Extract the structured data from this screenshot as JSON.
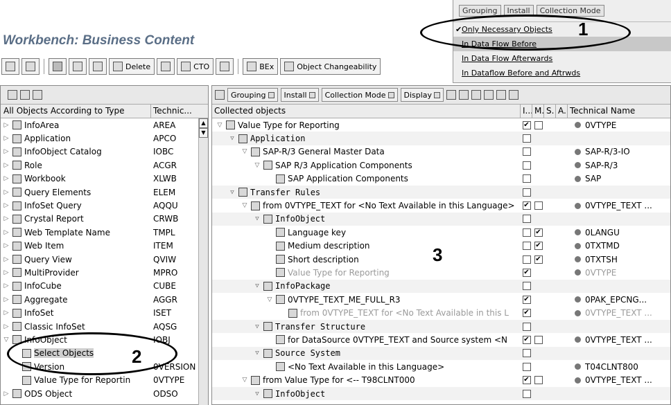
{
  "window": {
    "title": "Workbench: Business Content"
  },
  "toolbar": {
    "buttons": [
      "Delete",
      "CTO",
      "BEx",
      "Object Changeability"
    ]
  },
  "grouping_menu": {
    "top_buttons": [
      "Grouping",
      "Install",
      "Collection Mode"
    ],
    "items": [
      {
        "label": "Only Necessary Objects",
        "checked": true
      },
      {
        "label": "In Data Flow Before",
        "checked": false
      },
      {
        "label": "In Data Flow Afterwards",
        "checked": false
      },
      {
        "label": "In Dataflow Before and Aftrwds",
        "checked": false
      }
    ]
  },
  "callouts": {
    "c1": "1",
    "c2": "2",
    "c3": "3"
  },
  "left_panel": {
    "columns": [
      "All Objects According to Type",
      "Technic..."
    ],
    "rows": [
      {
        "name": "InfoArea",
        "tech": "AREA",
        "icon": "infoarea-icon"
      },
      {
        "name": "Application",
        "tech": "APCO",
        "icon": "application-icon"
      },
      {
        "name": "InfoObject Catalog",
        "tech": "IOBC",
        "icon": "infoobject-catalog-icon"
      },
      {
        "name": "Role",
        "tech": "ACGR",
        "icon": "role-icon"
      },
      {
        "name": "Workbook",
        "tech": "XLWB",
        "icon": "workbook-icon"
      },
      {
        "name": "Query Elements",
        "tech": "ELEM",
        "icon": "query-elements-icon"
      },
      {
        "name": "InfoSet Query",
        "tech": "AQQU",
        "icon": "infoset-query-icon"
      },
      {
        "name": "Crystal Report",
        "tech": "CRWB",
        "icon": "crystal-report-icon"
      },
      {
        "name": "Web Template Name",
        "tech": "TMPL",
        "icon": "web-template-icon"
      },
      {
        "name": "Web Item",
        "tech": "ITEM",
        "icon": "web-item-icon"
      },
      {
        "name": "Query View",
        "tech": "QVIW",
        "icon": "query-view-icon"
      },
      {
        "name": "MultiProvider",
        "tech": "MPRO",
        "icon": "multiprovider-icon"
      },
      {
        "name": "InfoCube",
        "tech": "CUBE",
        "icon": "infocube-icon"
      },
      {
        "name": "Aggregate",
        "tech": "AGGR",
        "icon": "aggregate-icon"
      },
      {
        "name": "InfoSet",
        "tech": "ISET",
        "icon": "infoset-icon"
      },
      {
        "name": "Classic InfoSet",
        "tech": "AQSG",
        "icon": "classic-infoset-icon"
      },
      {
        "name": "InfoObject",
        "tech": "IOBJ",
        "icon": "infoobject-icon",
        "expanded": true
      },
      {
        "name": "Select Objects",
        "tech": "",
        "icon": "select-objects-icon",
        "indent": 2,
        "selected": true
      },
      {
        "name": "Version",
        "tech": "0VERSION",
        "icon": "infoobject-icon",
        "indent": 2
      },
      {
        "name": "Value Type for Reportin",
        "tech": "0VTYPE",
        "icon": "infoobject-icon",
        "indent": 2
      },
      {
        "name": "ODS Object",
        "tech": "ODSO",
        "icon": "ods-object-icon"
      }
    ]
  },
  "right_panel": {
    "toolbar": [
      "Grouping",
      "Install",
      "Collection Mode",
      "Display"
    ],
    "columns": [
      "Collected objects",
      "I...",
      "M.",
      "S.",
      "A..",
      "Technical Name"
    ],
    "rows": [
      {
        "indent": 0,
        "name": "Value Type for Reporting",
        "i": true,
        "m": false,
        "tech": "0VTYPE",
        "icon": "infoobject-icon",
        "tri": "▽"
      },
      {
        "indent": 1,
        "name": "Application",
        "group": true,
        "tri": "▽",
        "icon": "application-icon"
      },
      {
        "indent": 2,
        "name": "SAP-R/3 General Master Data",
        "tech": "SAP-R/3-IO",
        "tri": "▽",
        "icon": "application-icon"
      },
      {
        "indent": 3,
        "name": "SAP R/3 Application Components",
        "tech": "SAP-R/3",
        "tri": "▽",
        "icon": "application-icon"
      },
      {
        "indent": 4,
        "name": "SAP Application Components",
        "tech": "SAP",
        "icon": "application-icon"
      },
      {
        "indent": 1,
        "name": "Transfer Rules",
        "group": true,
        "tri": "▽",
        "icon": "transfer-rules-icon"
      },
      {
        "indent": 2,
        "name": "from 0VTYPE_TEXT for <No Text Available in this Language>",
        "i": true,
        "m": false,
        "tech": "0VTYPE_TEXT ...",
        "tri": "▽",
        "icon": "transfer-rules-icon"
      },
      {
        "indent": 3,
        "name": "InfoObject",
        "group": true,
        "tri": "▽",
        "icon": "infoobject-icon"
      },
      {
        "indent": 4,
        "name": "Language key",
        "i": false,
        "m": true,
        "tech": "0LANGU",
        "icon": "infoobject-icon"
      },
      {
        "indent": 4,
        "name": "Medium description",
        "i": false,
        "m": true,
        "tech": "0TXTMD",
        "icon": "infoobject-icon"
      },
      {
        "indent": 4,
        "name": "Short description",
        "i": false,
        "m": true,
        "tech": "0TXTSH",
        "icon": "infoobject-icon"
      },
      {
        "indent": 4,
        "name": "Value Type for Reporting",
        "i": true,
        "tech": "0VTYPE",
        "grey": true,
        "icon": "infoobject-icon"
      },
      {
        "indent": 3,
        "name": "InfoPackage",
        "group": true,
        "tri": "▽",
        "icon": "infopackage-icon"
      },
      {
        "indent": 4,
        "name": "0VTYPE_TEXT_ME_FULL_R3",
        "i": true,
        "tech": "0PAK_EPCNG...",
        "tri": "▽",
        "icon": "infopackage-icon"
      },
      {
        "indent": 5,
        "name": "from 0VTYPE_TEXT for <No Text Available in this L",
        "i": true,
        "tech": "0VTYPE_TEXT ...",
        "grey": true,
        "icon": "transfer-rules-icon"
      },
      {
        "indent": 3,
        "name": "Transfer Structure",
        "group": true,
        "tri": "▽",
        "icon": "transfer-structure-icon"
      },
      {
        "indent": 4,
        "name": "for DataSource 0VTYPE_TEXT and Source system <N",
        "i": true,
        "m": false,
        "tech": "0VTYPE_TEXT ...",
        "icon": "transfer-structure-icon"
      },
      {
        "indent": 3,
        "name": "Source System",
        "group": true,
        "tri": "▽",
        "icon": "source-system-icon"
      },
      {
        "indent": 4,
        "name": "<No Text Available in this Language>",
        "tech": "T04CLNT800",
        "icon": "source-system-icon"
      },
      {
        "indent": 2,
        "name": "from Value Type for <-- T98CLNT000",
        "i": true,
        "m": false,
        "tech": "0VTYPE_TEXT ...",
        "tri": "▽",
        "icon": "transfer-rules-icon"
      },
      {
        "indent": 3,
        "name": "InfoObject",
        "group": true,
        "tri": "▽",
        "icon": "infoobject-icon"
      }
    ]
  }
}
